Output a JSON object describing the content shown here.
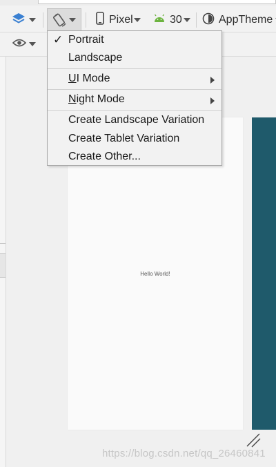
{
  "toolbar": {
    "device_label": "Pixel",
    "api_label": "30",
    "theme_label": "AppTheme"
  },
  "orientation_menu": {
    "items": [
      {
        "label": "Portrait",
        "checked": true
      },
      {
        "label": "Landscape"
      },
      {
        "label_first": "U",
        "label_rest": "I Mode",
        "submenu": true
      },
      {
        "label_first": "N",
        "label_rest": "ight Mode",
        "submenu": true
      },
      {
        "label": "Create Landscape Variation"
      },
      {
        "label": "Create Tablet Variation"
      },
      {
        "label": "Create Other..."
      }
    ]
  },
  "preview": {
    "hello_text": "Hello World!",
    "blueprint_color": "#1f5a6b"
  },
  "watermark": "https://blog.csdn.net/qq_26460841",
  "icons": [
    "layers-icon",
    "rotate-icon",
    "phone-icon",
    "android-icon",
    "theme-icon",
    "eye-icon",
    "resize-handle-icon"
  ],
  "check_mark": "✓"
}
